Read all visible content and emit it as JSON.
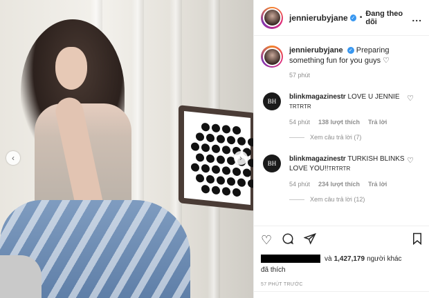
{
  "header": {
    "username": "jennierubyjane",
    "separator": "•",
    "follow_status": "Đang theo dõi",
    "more": "..."
  },
  "caption": {
    "username": "jennierubyjane",
    "text": "Preparing something fun for you guys ♡",
    "time": "57 phút"
  },
  "comments": [
    {
      "avatar_text": "BH",
      "username": "blinkmagazinestr",
      "text": "LOVE U JENNIE",
      "text_small": "TRTRTR",
      "time": "54 phút",
      "likes": "138 lượt thích",
      "reply": "Trả lời",
      "view_replies": "Xem câu trả lời (7)"
    },
    {
      "avatar_text": "BH",
      "username": "blinkmagazinestr",
      "text": "TURKISH BLINKS LOVE YOU!!",
      "text_small": "TRTRTR",
      "time": "54 phút",
      "likes": "234 lượt thích",
      "reply": "Trả lời",
      "view_replies": "Xem câu trả lời (12)"
    }
  ],
  "actions": {
    "like_icon": "heart-icon",
    "comment_icon": "comment-icon",
    "share_icon": "share-icon",
    "save_icon": "bookmark-icon"
  },
  "likes": {
    "prefix": "và",
    "count": "1,427,179",
    "suffix": "người khác",
    "liked": "đã thích"
  },
  "posted": "57 PHÚT TRƯỚC",
  "colors": {
    "verified": "#3897f0",
    "muted": "#8e8e8e",
    "text": "#262626"
  }
}
